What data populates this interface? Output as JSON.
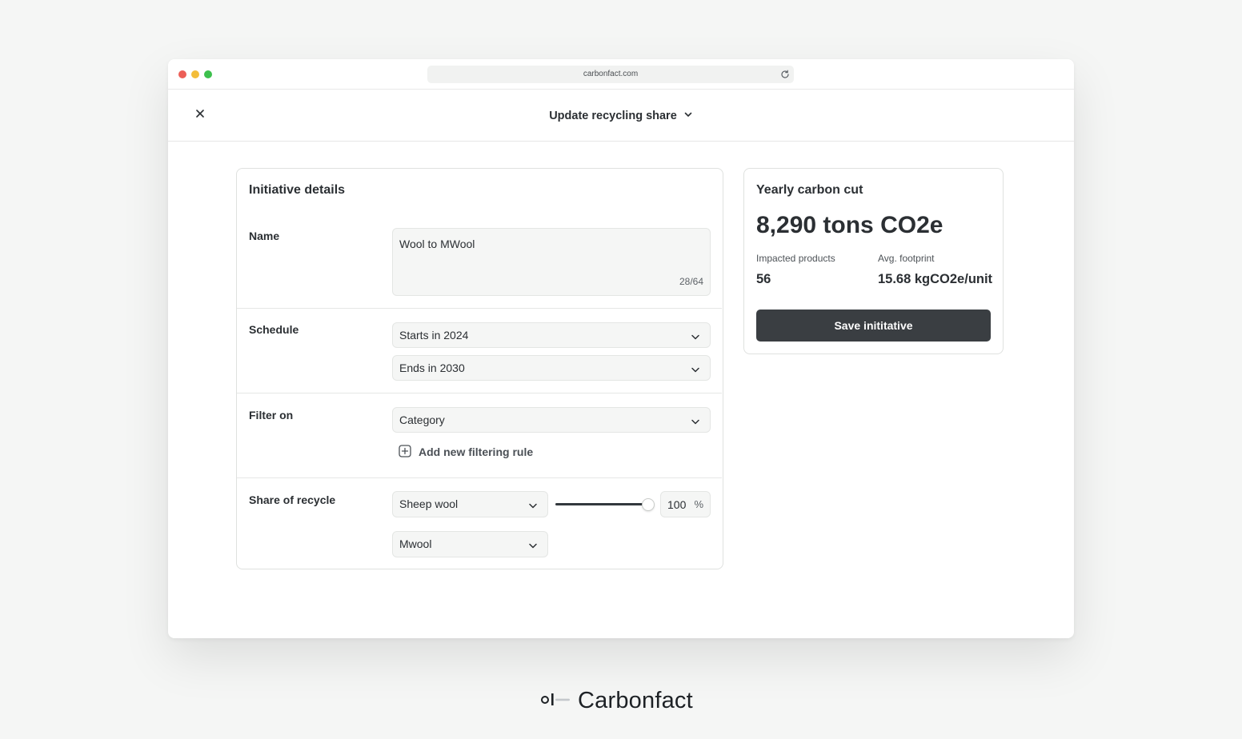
{
  "browser": {
    "url": "carbonfact.com"
  },
  "header": {
    "title": "Update recycling share"
  },
  "details": {
    "title": "Initiative details",
    "name": {
      "label": "Name",
      "value": "Wool to MWool",
      "char_count": "28/64"
    },
    "schedule": {
      "label": "Schedule",
      "start": "Starts in 2024",
      "end": "Ends in 2030"
    },
    "filter": {
      "label": "Filter on",
      "value": "Category",
      "add_rule": "Add new filtering rule"
    },
    "share": {
      "label": "Share of recycle",
      "from_material": "Sheep wool",
      "to_material": "Mwool",
      "percent_value": "100",
      "percent_unit": "%",
      "slider_fraction": 1.0
    }
  },
  "summary": {
    "title": "Yearly carbon cut",
    "total": "8,290 tons CO2e",
    "impacted_label": "Impacted products",
    "impacted_value": "56",
    "footprint_label": "Avg. footprint",
    "footprint_value": "15.68 kgCO2e/unit",
    "save_label": "Save inititative"
  },
  "brand": {
    "name": "Carbonfact"
  },
  "colors": {
    "background": "#f5f6f5",
    "primary_button": "#3a3e42",
    "traffic_red": "#ec5f57",
    "traffic_yellow": "#f3bd3a",
    "traffic_green": "#3dc04d"
  }
}
